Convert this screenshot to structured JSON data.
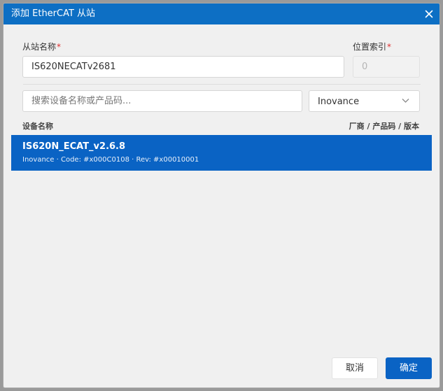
{
  "dialog": {
    "title": "添加 EtherCAT 从站",
    "close_icon": "close-icon"
  },
  "form": {
    "slave_name_label": "从站名称",
    "slave_name_value": "IS620NECATv2681",
    "position_index_label": "位置索引",
    "position_index_value": "0",
    "required_mark": "*"
  },
  "search": {
    "placeholder": "搜索设备名称或产品码...",
    "value": ""
  },
  "vendor_filter": {
    "selected": "Inovance",
    "icon": "chevron-down-icon"
  },
  "device_list": {
    "header_left": "设备名称",
    "header_right": "厂商 / 产品码 / 版本",
    "items": [
      {
        "name": "IS620N_ECAT_v2.6.8",
        "details": "Inovance · Code: #x000C0108 · Rev: #x00010001",
        "selected": true
      }
    ]
  },
  "footer": {
    "cancel_label": "取消",
    "ok_label": "确定"
  },
  "colors": {
    "accent": "#0a63c4",
    "titlebar": "#0d6fc4",
    "required": "#e03030"
  }
}
